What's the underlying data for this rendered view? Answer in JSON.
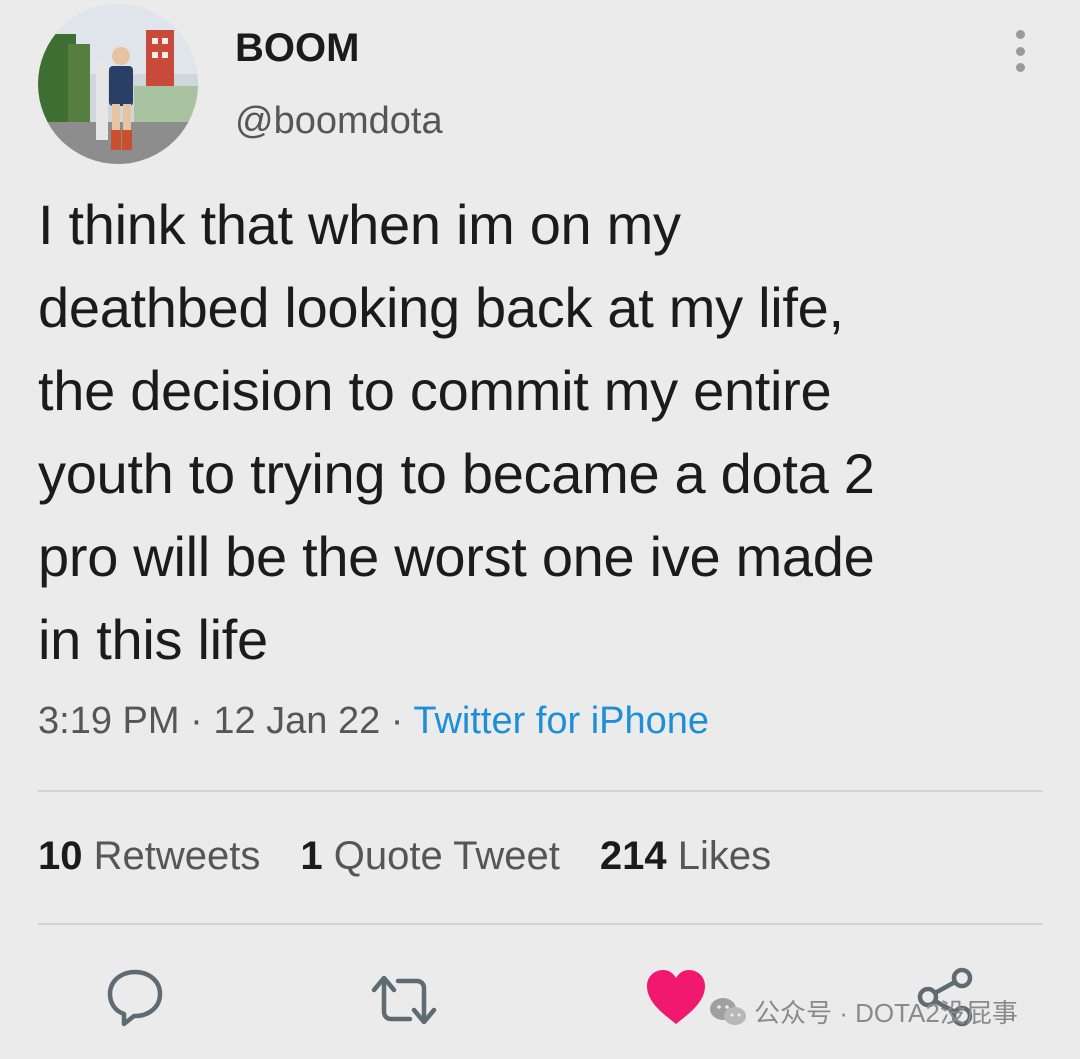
{
  "user": {
    "display_name": "BOOM",
    "handle": "@boomdota"
  },
  "tweet": {
    "text": "I think that when im on my\ndeathbed looking back at my life,\nthe decision to commit my entire\nyouth to trying to became a dota 2\npro will be the worst one ive made\nin this life",
    "time": "3:19 PM",
    "date": "12 Jan 22",
    "source": "Twitter for iPhone",
    "separator": "·"
  },
  "stats": {
    "retweets_count": "10",
    "retweets_label": "Retweets",
    "quotes_count": "1",
    "quotes_label": "Quote Tweet",
    "likes_count": "214",
    "likes_label": "Likes"
  },
  "actions": {
    "reply_icon": "reply-icon",
    "retweet_icon": "retweet-icon",
    "like_icon": "heart-icon",
    "share_icon": "share-icon"
  },
  "watermark": {
    "text": "公众号 · DOTA2没屁事"
  },
  "colors": {
    "background": "#ebebeb",
    "link": "#1d8fd8",
    "like": "#f0186f",
    "icon": "#5f6b73"
  }
}
